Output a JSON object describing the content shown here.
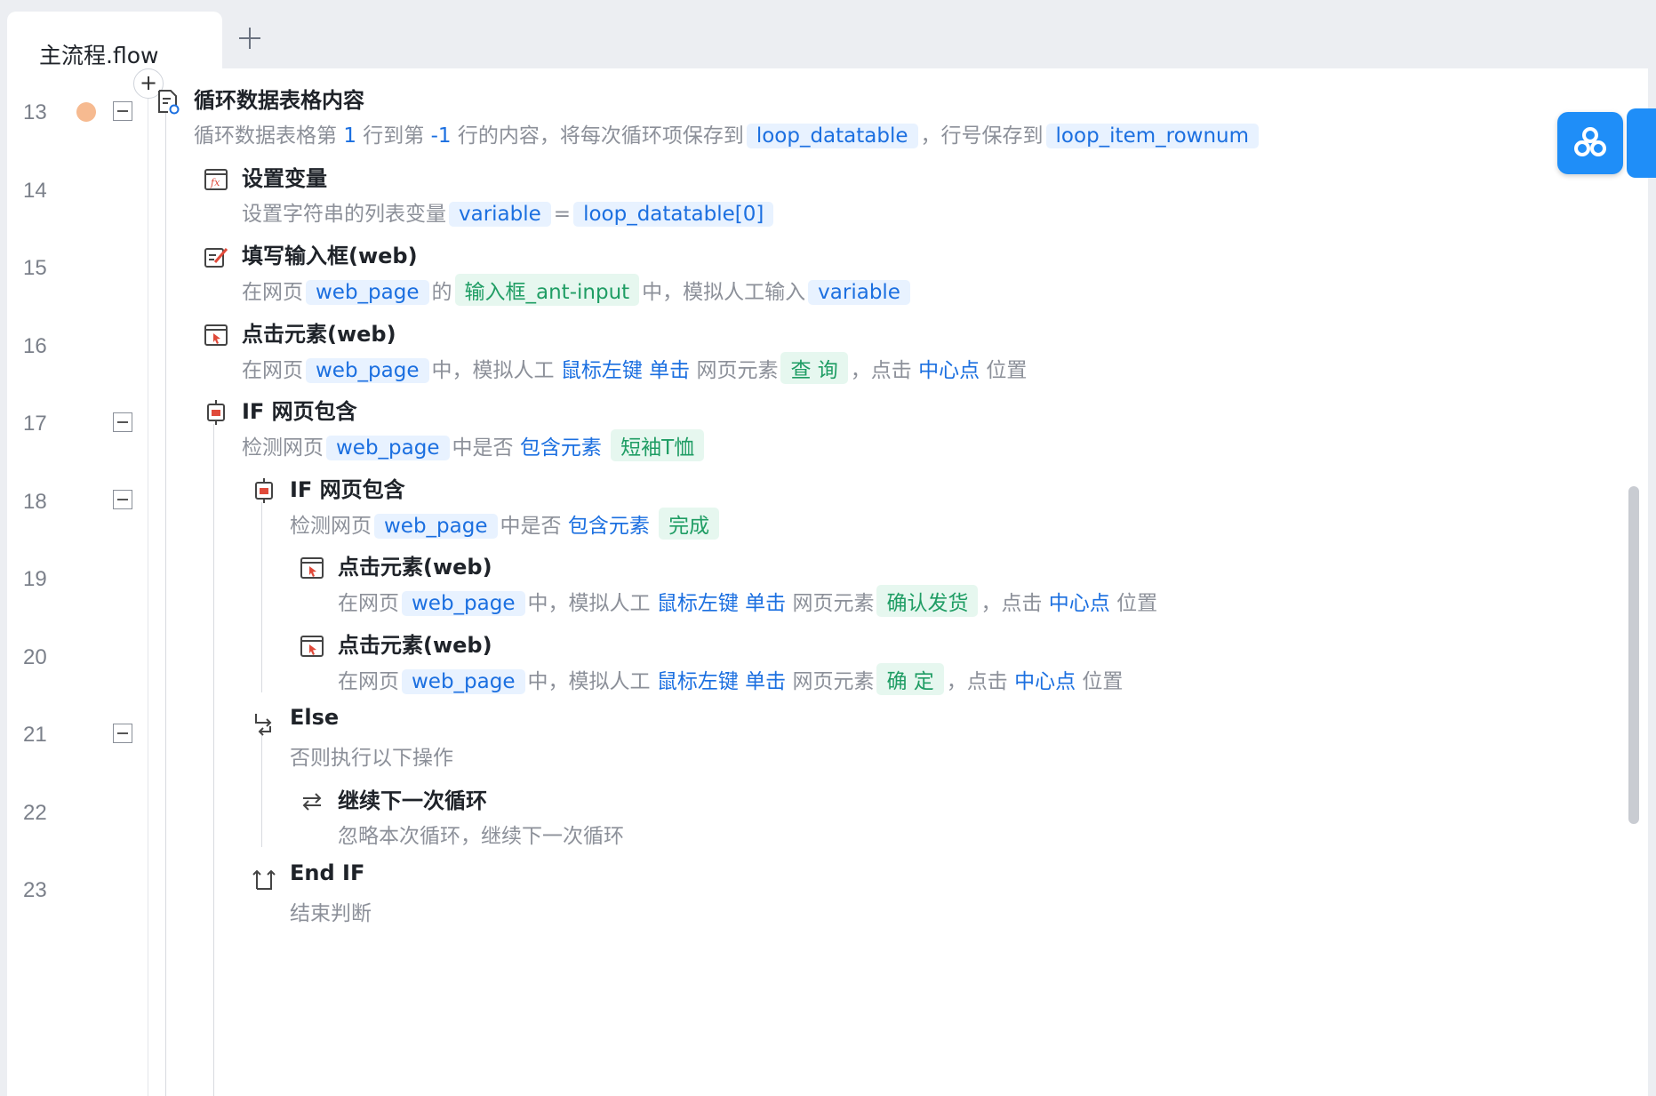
{
  "tabs": [
    {
      "label": "主流程.flow",
      "active": true
    }
  ],
  "add_tab_icon": "plus-icon",
  "insert_step_icon": "plus-icon",
  "colors": {
    "accent": "#1b6fe0",
    "element_chip": "#1f9d64",
    "breakpoint": "#f6ba90",
    "side_button": "#1f8ef8"
  },
  "line_numbers": [
    "13",
    "14",
    "15",
    "16",
    "17",
    "18",
    "19",
    "20",
    "21",
    "22",
    "23"
  ],
  "steps": [
    {
      "line": "13",
      "icon": "loop-table-icon",
      "title": "循环数据表格内容",
      "desc": {
        "p1": "循环数据表格第",
        "n1": "1",
        "p2": "行到第",
        "n2": "-1",
        "p3": "行的内容，将每次循环项保存到",
        "v1": "loop_datatable",
        "p4": "，行号保存到",
        "v2": "loop_item_rownum"
      }
    },
    {
      "line": "14",
      "icon": "fx-icon",
      "title": "设置变量",
      "desc": {
        "p1": "设置字符串的列表变量",
        "v1": "variable",
        "p2": "=",
        "v2": "loop_datatable[0]"
      }
    },
    {
      "line": "15",
      "icon": "edit-input-icon",
      "title": "填写输入框(web)",
      "desc": {
        "p1": "在网页",
        "v1": "web_page",
        "p2": "的",
        "e1": "输入框_ant-input",
        "p3": "中，模拟人工输入",
        "v2": "variable"
      }
    },
    {
      "line": "16",
      "icon": "click-element-icon",
      "title": "点击元素(web)",
      "desc": {
        "p1": "在网页",
        "v1": "web_page",
        "p2": "中，模拟人工",
        "k1": "鼠标左键",
        "k2": "单击",
        "p3": "网页元素",
        "e1": "查 询",
        "p4": "，点击",
        "k3": "中心点",
        "p5": "位置"
      }
    },
    {
      "line": "17",
      "icon": "if-contains-icon",
      "title": "IF 网页包含",
      "desc": {
        "p1": "检测网页",
        "v1": "web_page",
        "p2": "中是否",
        "k1": "包含元素",
        "e1": "短袖T恤"
      }
    },
    {
      "line": "18",
      "icon": "if-contains-icon",
      "title": "IF 网页包含",
      "desc": {
        "p1": "检测网页",
        "v1": "web_page",
        "p2": "中是否",
        "k1": "包含元素",
        "e1": "完成"
      }
    },
    {
      "line": "19",
      "icon": "click-element-icon",
      "title": "点击元素(web)",
      "desc": {
        "p1": "在网页",
        "v1": "web_page",
        "p2": "中，模拟人工",
        "k1": "鼠标左键",
        "k2": "单击",
        "p3": "网页元素",
        "e1": "确认发货",
        "p4": "，点击",
        "k3": "中心点",
        "p5": "位置"
      }
    },
    {
      "line": "20",
      "icon": "click-element-icon",
      "title": "点击元素(web)",
      "desc": {
        "p1": "在网页",
        "v1": "web_page",
        "p2": "中，模拟人工",
        "k1": "鼠标左键",
        "k2": "单击",
        "p3": "网页元素",
        "e1": "确 定",
        "p4": "，点击",
        "k3": "中心点",
        "p5": "位置"
      }
    },
    {
      "line": "21",
      "icon": "else-branch-icon",
      "title": "Else",
      "desc": {
        "p1": "否则执行以下操作"
      }
    },
    {
      "line": "22",
      "icon": "continue-loop-icon",
      "title": "继续下一次循环",
      "desc": {
        "p1": "忽略本次循环，继续下一次循环"
      }
    },
    {
      "line": "23",
      "icon": "end-if-icon",
      "title": "End IF",
      "desc": {
        "p1": "结束判断"
      }
    }
  ],
  "side_button_icon": "cloud-link-icon"
}
